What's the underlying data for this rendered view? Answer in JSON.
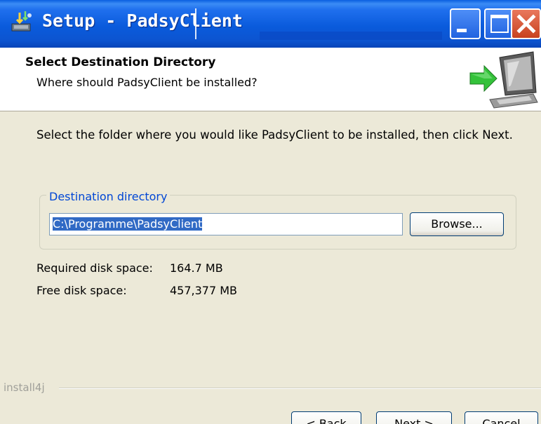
{
  "window": {
    "title": "Setup - PadsyClient"
  },
  "header": {
    "title": "Select Destination Directory",
    "subtitle": "Where should PadsyClient be installed?"
  },
  "content": {
    "description": "Select the folder where you would like PadsyClient to be installed, then click Next.",
    "group_label": "Destination directory",
    "directory_value": "C:\\Programme\\PadsyClient",
    "browse_label": "Browse...",
    "required_label": "Required disk space:",
    "required_value": "164.7 MB",
    "free_label": "Free disk space:",
    "free_value": "457,377 MB"
  },
  "footer": {
    "brand": "install4j",
    "back_label": "< Back",
    "next_label": "Next >",
    "cancel_label": "Cancel"
  },
  "colors": {
    "titlebar": "#0A5BDC",
    "dialog_bg": "#ECE9D8",
    "group_label": "#0046D5",
    "selection": "#316AC5"
  }
}
